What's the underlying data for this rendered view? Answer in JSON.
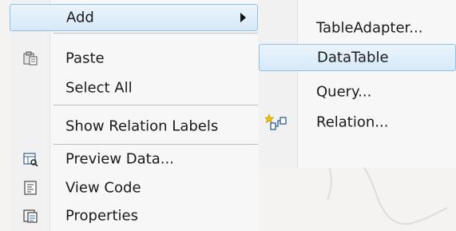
{
  "context_menu": {
    "items": [
      {
        "label": "Add",
        "icon": "",
        "submenu": true,
        "highlighted": true
      },
      {
        "label": "Paste",
        "icon": "paste-icon"
      },
      {
        "label": "Select All",
        "icon": ""
      },
      {
        "label": "Show Relation Labels",
        "icon": ""
      },
      {
        "label": "Preview Data...",
        "icon": "preview-data-icon"
      },
      {
        "label": "View Code",
        "icon": "view-code-icon"
      },
      {
        "label": "Properties",
        "icon": "properties-icon"
      }
    ]
  },
  "submenu": {
    "items": [
      {
        "label": "TableAdapter..."
      },
      {
        "label": "DataTable",
        "highlighted": true
      },
      {
        "label": "Query..."
      },
      {
        "label": "Relation...",
        "icon": "relation-icon"
      }
    ]
  },
  "colors": {
    "highlight_border": "#8fbfe4",
    "highlight_fill": "#d6e9f8",
    "menu_background": "#f7f7f7"
  }
}
